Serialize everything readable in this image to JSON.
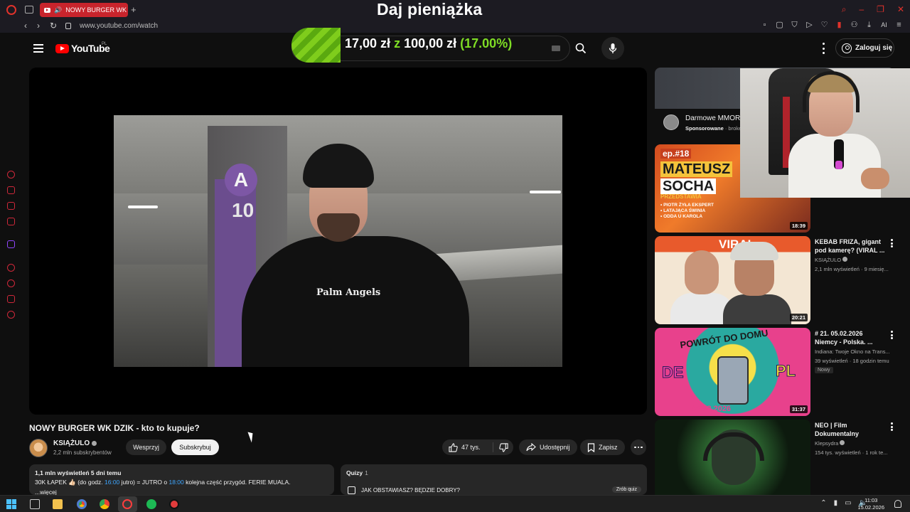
{
  "browser": {
    "tab_title": "NOWY BURGER WK DZ",
    "url": "www.youtube.com/watch",
    "ai_label": "AI"
  },
  "overlay": {
    "title": "Daj pieniążka",
    "donation_current": "17,00 zł",
    "donation_sep": "z",
    "donation_goal": "100,00 zł",
    "donation_pct": "(17.00%)",
    "donation_progress": 0.17
  },
  "header": {
    "logo": "YouTube",
    "region": "PL",
    "login": "Zaloguj się"
  },
  "video": {
    "title": "NOWY BURGER WK DZIK - kto to kupuje?",
    "shirt_text": "Palm Angels",
    "pillar_letter": "A",
    "pillar_number": "10",
    "channel": "KSIĄŻULO",
    "subscribers": "2,2 mln subskrybentów",
    "support_label": "Wesprzyj",
    "subscribe_label": "Subskrybuj",
    "likes": "47 tys.",
    "share_label": "Udostępnij",
    "save_label": "Zapisz"
  },
  "description": {
    "stats": "1,1 mln wyświetleń  5 dni temu",
    "line_prefix": "30K ŁAPEK 👍🏻 (do godz. ",
    "time1": "16:00",
    "line_mid": " jutro) = JUTRO o ",
    "time2": "18:00",
    "line_suffix": " kolejna część przygód. FERIE MUALA.",
    "more": "...więcej"
  },
  "quiz": {
    "label": "Quizy",
    "count": "1",
    "question": "JAK OBSTAWIASZ? BĘDZIE DOBRY?",
    "button": "Zrób quiz"
  },
  "ad": {
    "title": "Darmowe MMOR",
    "sponsored": "Sponsorowane",
    "advertiser": " · broke"
  },
  "recommendations": [
    {
      "duration": "18:39",
      "thumb_ep": "ep.#18",
      "thumb_name": "MATEUSZ",
      "thumb_name2": "SOCHA",
      "thumb_sub": "PRZEDSTAWIA",
      "thumb_bullets": "• PIOTR ŻYŁA EKSPERT\n• LATAJĄCA ŚWINIA\n• ODDA U KAROLA"
    },
    {
      "title": "KEBAB FRIZA, gigant pod kamerę? (VIRAL ...",
      "channel": "KSIĄŻULO",
      "meta": "2,1 mln wyświetleń · 9 miesię...",
      "duration": "20:21",
      "thumb_text": "VIRAL"
    },
    {
      "title": "# 21.  05.02.2026 Niemcy - Polska.  ...",
      "channel": "Indiana: Twoje Okno na Trans...",
      "meta": "39 wyświetleń · 18 godzin temu",
      "badge": "Nowy",
      "duration": "31:37",
      "thumb_top": "POWRÓT DO DOMU",
      "thumb_de": "DE",
      "thumb_pl": "PL",
      "thumb_date": "05.02.2026"
    },
    {
      "title": "NEO | Film Dokumentalny",
      "channel": "Klepsydra",
      "meta": "154 tys. wyświetleń · 1 rok te..."
    }
  ],
  "taskbar": {
    "time": "11:03",
    "date": "15.02.2026"
  },
  "colors": {
    "yt_red": "#ff0000",
    "donation_green": "#7fdd25",
    "opera_red": "#e0322b",
    "link_blue": "#3ea6ff"
  }
}
